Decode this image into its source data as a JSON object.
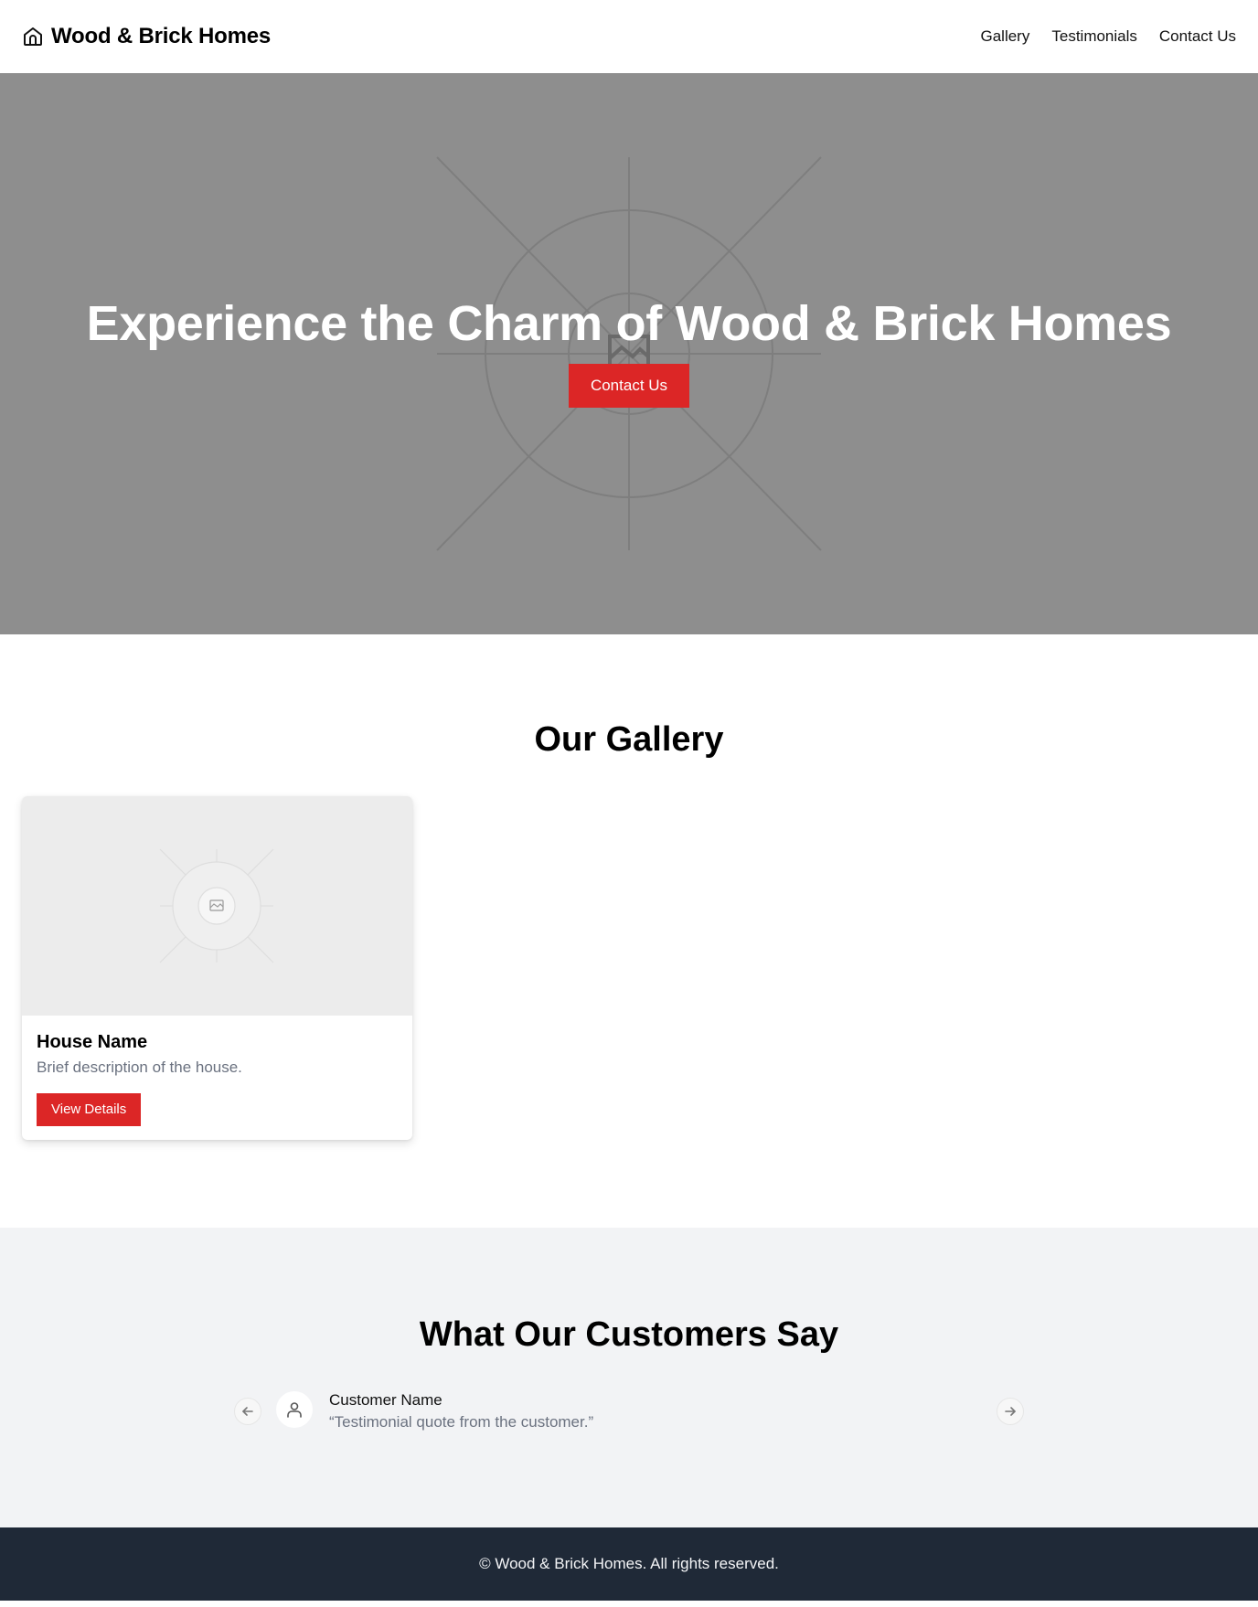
{
  "header": {
    "brand": "Wood & Brick Homes",
    "brand_icon": "home-icon",
    "nav": [
      {
        "label": "Gallery"
      },
      {
        "label": "Testimonials"
      },
      {
        "label": "Contact Us"
      }
    ]
  },
  "hero": {
    "title": "Experience the Charm of Wood & Brick Homes",
    "cta_label": "Contact Us",
    "background_icon": "image-placeholder-icon"
  },
  "gallery": {
    "title": "Our Gallery",
    "cards": [
      {
        "title": "House Name",
        "description": "Brief description of the house.",
        "button_label": "View Details",
        "image_icon": "image-placeholder-icon"
      }
    ]
  },
  "testimonials": {
    "title": "What Our Customers Say",
    "items": [
      {
        "name": "Customer Name",
        "quote": "“Testimonial quote from the customer.”",
        "avatar_icon": "user-icon"
      }
    ],
    "prev_icon": "arrow-left-icon",
    "next_icon": "arrow-right-icon"
  },
  "footer": {
    "text": "© Wood & Brick Homes. All rights reserved."
  },
  "colors": {
    "accent": "#dc2626",
    "hero_bg": "#8e8e8e",
    "footer_bg": "#1f2937",
    "testimonials_bg": "#f2f3f5"
  }
}
